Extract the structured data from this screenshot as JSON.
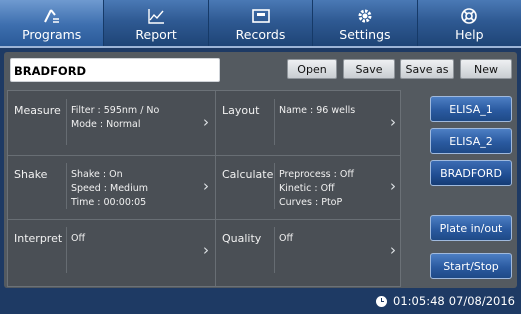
{
  "nav": {
    "tabs": [
      {
        "label": "Programs",
        "icon": "programs-icon",
        "active": true
      },
      {
        "label": "Report",
        "icon": "chart-icon",
        "active": false
      },
      {
        "label": "Records",
        "icon": "records-icon",
        "active": false
      },
      {
        "label": "Settings",
        "icon": "gear-icon",
        "active": false
      },
      {
        "label": "Help",
        "icon": "lifebuoy-icon",
        "active": false
      }
    ]
  },
  "program": {
    "name": "BRADFORD"
  },
  "toolbar": {
    "open": "Open",
    "save": "Save",
    "save_as": "Save as",
    "new": "New"
  },
  "params": {
    "measure": {
      "label": "Measure",
      "line1": "Filter :  595nm / No",
      "line2": "Mode : Normal"
    },
    "layout": {
      "label": "Layout",
      "line1": "Name : 96 wells"
    },
    "shake": {
      "label": "Shake",
      "line1": "Shake : On",
      "line2": "Speed : Medium",
      "line3": "Time :  00:00:05"
    },
    "calculate": {
      "label": "Calculate",
      "line1": "Preprocess : Off",
      "line2": "Kinetic : Off",
      "line3": "Curves : PtoP"
    },
    "interpret": {
      "label": "Interpret",
      "line1": "Off"
    },
    "quality": {
      "label": "Quality",
      "line1": "Off"
    }
  },
  "side": {
    "programs": [
      "ELISA_1",
      "ELISA_2",
      "BRADFORD"
    ],
    "selected": "BRADFORD",
    "plate": "Plate in/out",
    "startstop": "Start/Stop"
  },
  "status": {
    "time": "01:05:48",
    "date": "07/08/2016"
  },
  "colors": {
    "nav_bg": "#2f5a93",
    "panel_bg": "#4a4f55",
    "accent_button": "#2a5aa0"
  }
}
